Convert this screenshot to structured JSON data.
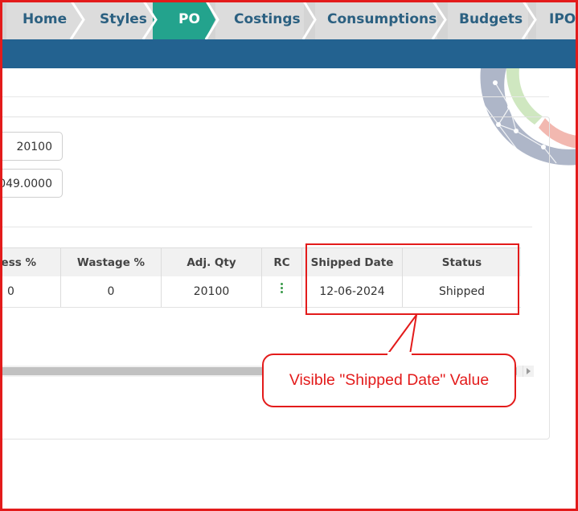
{
  "nav": {
    "tabs": [
      {
        "label": "Home"
      },
      {
        "label": "Styles"
      },
      {
        "label": "PO",
        "active": true
      },
      {
        "label": "Costings"
      },
      {
        "label": "Consumptions"
      },
      {
        "label": "Budgets"
      },
      {
        "label": "IPO"
      }
    ]
  },
  "form": {
    "qty_value": "20100",
    "amount_value": "049.0000"
  },
  "table": {
    "headers": [
      "ess %",
      "Wastage %",
      "Adj. Qty",
      "RC",
      "Shipped Date",
      "Status"
    ],
    "rows": [
      {
        "excess": "0",
        "wastage": "0",
        "adj_qty": "20100",
        "rc_icon": "kebab-menu-icon",
        "shipped_date": "12-06-2024",
        "status": "Shipped"
      }
    ]
  },
  "annotation": {
    "callout_text": "Visible \"Shipped Date\" Value",
    "color": "#e31b1b"
  },
  "colors": {
    "active_tab": "#23a38d",
    "tab_text": "#2b6081",
    "blue_bar": "#236290"
  }
}
